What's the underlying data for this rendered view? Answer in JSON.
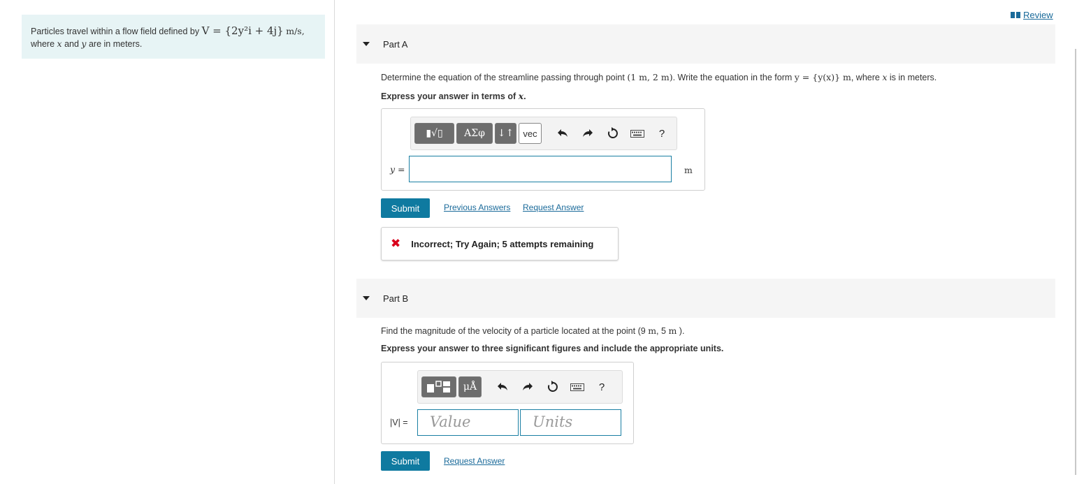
{
  "problem": {
    "prefix": "Particles travel within a flow field defined by",
    "formula": "V = {2y²i + 4j}",
    "unit": "m/s,",
    "line2_where": "where",
    "var_x": "x",
    "and": "and",
    "var_y": "y",
    "suffix": "are in meters."
  },
  "review": {
    "label": "Review"
  },
  "partA": {
    "title": "Part A",
    "question_pre": "Determine the equation of the streamline passing through point",
    "point": "(1 m, 2 m)",
    "question_mid": ". Write the equation in the form",
    "form": "y = {y(x)} m",
    "question_post": ", where",
    "var_x": "x",
    "question_end": "is in meters.",
    "instruction_pre": "Express your answer in terms of",
    "instruction_var": "x",
    "instruction_end": ".",
    "toolbar": {
      "templates_label": "▮√▯",
      "greek_label": "ΑΣφ",
      "arrows_label": "↓↑",
      "vec_label": "vec",
      "undo_icon": "undo-icon",
      "redo_icon": "redo-icon",
      "reset_icon": "reset-icon",
      "keyboard_icon": "keyboard-icon",
      "help_label": "?"
    },
    "input_label": "y =",
    "unit": "m",
    "input_value": "",
    "submit": "Submit",
    "previous_answers": "Previous Answers",
    "request_answer": "Request Answer",
    "feedback_icon": "✖",
    "feedback": "Incorrect; Try Again; 5 attempts remaining"
  },
  "partB": {
    "title": "Part B",
    "question_pre": "Find the magnitude of the velocity of a particle located at the point (9",
    "u1": "m",
    "comma": ", 5",
    "u2": "m",
    "close": ").",
    "instruction": "Express your answer to three significant figures and include the appropriate units.",
    "toolbar": {
      "templates_label": "▪▫",
      "units_label": "μÅ",
      "help_label": "?"
    },
    "input_label": "|V| =",
    "value_placeholder": "Value",
    "units_placeholder": "Units",
    "submit": "Submit",
    "request_answer": "Request Answer"
  },
  "colors": {
    "accent": "#0f7aa0",
    "link": "#1a6a9a",
    "error": "#d9001b",
    "problem_bg": "#e7f4f5"
  }
}
